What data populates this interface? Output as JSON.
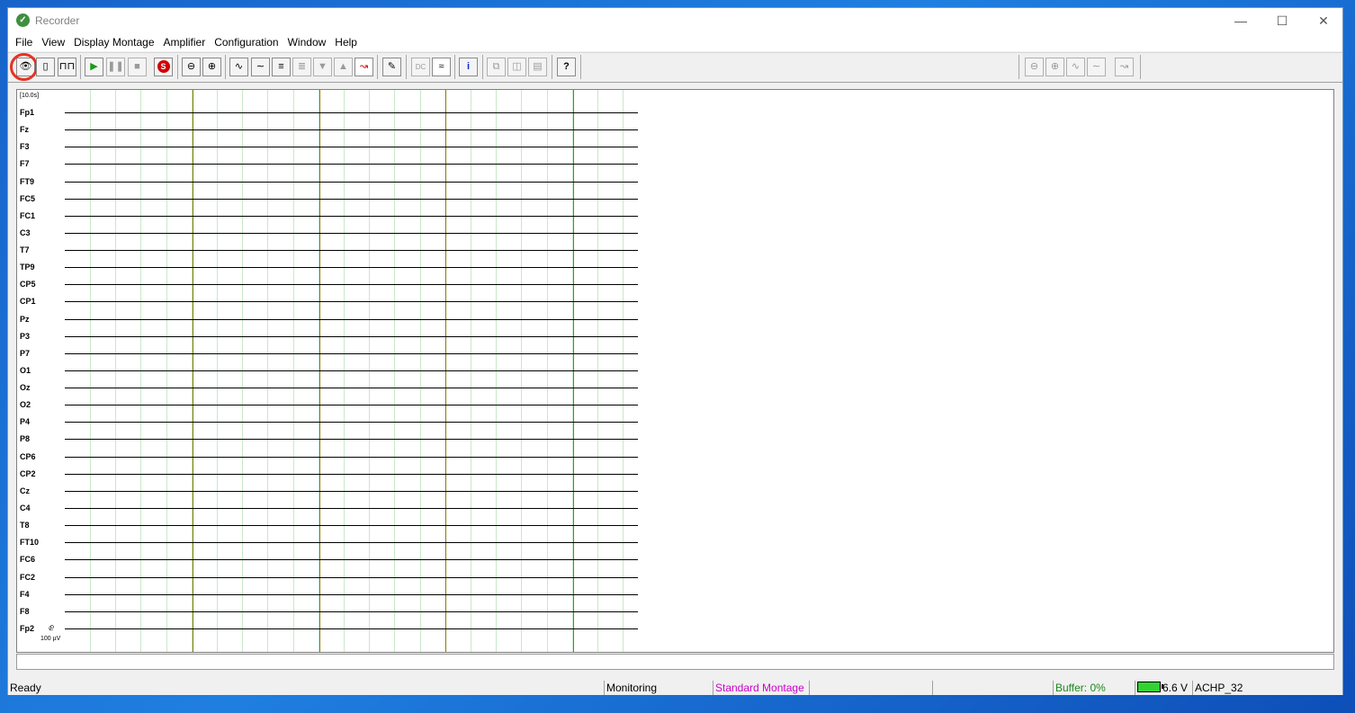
{
  "window": {
    "title": "Recorder"
  },
  "menu": [
    "File",
    "View",
    "Display Montage",
    "Amplifier",
    "Configuration",
    "Window",
    "Help"
  ],
  "plot": {
    "timebase": "[10.0s]",
    "channels": [
      "Fp1",
      "Fz",
      "F3",
      "F7",
      "FT9",
      "FC5",
      "FC1",
      "C3",
      "T7",
      "TP9",
      "CP5",
      "CP1",
      "Pz",
      "P3",
      "P7",
      "O1",
      "Oz",
      "O2",
      "P4",
      "P8",
      "CP6",
      "CP2",
      "Cz",
      "C4",
      "T8",
      "FT10",
      "FC6",
      "FC2",
      "F4",
      "F8",
      "Fp2"
    ],
    "scale_label": "100 µV"
  },
  "status": {
    "ready": "Ready",
    "mode": "Monitoring",
    "montage": "Standard Montage",
    "buffer": "Buffer: 0%",
    "battery": "6.6 V",
    "amplifier": "ACHP_32"
  },
  "colors": {
    "montage": "#cc00cc",
    "buffer": "#1a8a1a",
    "highlight": "#e53322"
  }
}
